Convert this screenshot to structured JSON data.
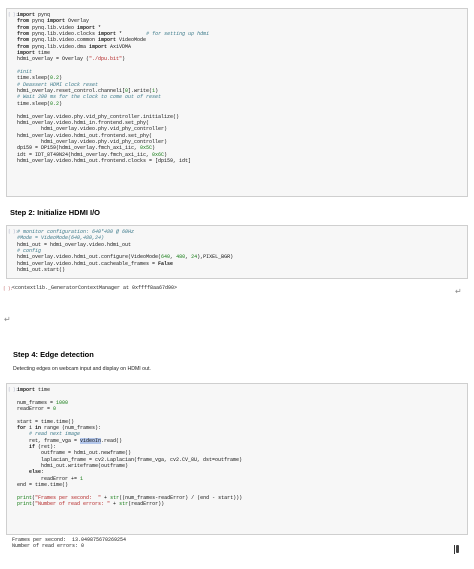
{
  "cell1": {
    "lines": [
      [
        {
          "t": "import",
          "c": "kw"
        },
        {
          "t": " pynq"
        }
      ],
      [
        {
          "t": "from",
          "c": "kw"
        },
        {
          "t": " pynq "
        },
        {
          "t": "import",
          "c": "kw"
        },
        {
          "t": " Overlay"
        }
      ],
      [
        {
          "t": "from",
          "c": "kw"
        },
        {
          "t": " pynq.lib.video "
        },
        {
          "t": "import",
          "c": "kw"
        },
        {
          "t": " *"
        }
      ],
      [
        {
          "t": "from",
          "c": "kw"
        },
        {
          "t": " pynq.lib.video.clocks "
        },
        {
          "t": "import",
          "c": "kw"
        },
        {
          "t": " *        "
        },
        {
          "t": "# for setting up hdmi",
          "c": "cm"
        }
      ],
      [
        {
          "t": "from",
          "c": "kw"
        },
        {
          "t": " pynq.lib.video.common "
        },
        {
          "t": "import",
          "c": "kw"
        },
        {
          "t": " VideoMode"
        }
      ],
      [
        {
          "t": "from",
          "c": "kw"
        },
        {
          "t": " pynq.lib.video.dma "
        },
        {
          "t": "import",
          "c": "kw"
        },
        {
          "t": " AxiVDMA"
        }
      ],
      [
        {
          "t": "import",
          "c": "kw"
        },
        {
          "t": " time"
        }
      ],
      [
        {
          "t": "hdmi_overlay = Overlay ("
        },
        {
          "t": "\"./dpu.bit\"",
          "c": "st"
        },
        {
          "t": ")"
        }
      ],
      [
        {
          "t": ""
        }
      ],
      [
        {
          "t": "#init",
          "c": "cm"
        }
      ],
      [
        {
          "t": "time.sleep("
        },
        {
          "t": "0.2",
          "c": "nm"
        },
        {
          "t": ")"
        }
      ],
      [
        {
          "t": "# Deassert HDMI clock reset",
          "c": "cm"
        }
      ],
      [
        {
          "t": "hdmi_overlay.reset_control.channel1["
        },
        {
          "t": "0",
          "c": "nm"
        },
        {
          "t": "].write("
        },
        {
          "t": "1",
          "c": "nm"
        },
        {
          "t": ")"
        }
      ],
      [
        {
          "t": "# Wait 200 ms for the clock to come out of reset",
          "c": "cm"
        }
      ],
      [
        {
          "t": "time.sleep("
        },
        {
          "t": "0.2",
          "c": "nm"
        },
        {
          "t": ")"
        }
      ],
      [
        {
          "t": ""
        }
      ],
      [
        {
          "t": "hdmi_overlay.video.phy.vid_phy_controller.initialize()"
        }
      ],
      [
        {
          "t": "hdmi_overlay.video.hdmi_in.frontend.set_phy("
        }
      ],
      [
        {
          "t": "        hdmi_overlay.video.phy.vid_phy_controller)"
        }
      ],
      [
        {
          "t": "hdmi_overlay.video.hdmi_out.frontend.set_phy("
        }
      ],
      [
        {
          "t": "        hdmi_overlay.video.phy.vid_phy_controller)"
        }
      ],
      [
        {
          "t": "dp159 = DP159(hdmi_overlay.fmch_axi_iic, "
        },
        {
          "t": "0x5C",
          "c": "nm"
        },
        {
          "t": ")"
        }
      ],
      [
        {
          "t": "idt = IDT_8T49N24(hdmi_overlay.fmch_axi_iic, "
        },
        {
          "t": "0x6C",
          "c": "nm"
        },
        {
          "t": ")"
        }
      ],
      [
        {
          "t": "hdmi_overlay.video.hdmi_out.frontend.clocks = [dp159, idt]"
        }
      ]
    ]
  },
  "heading_step2": "Step 2: Initialize HDMI I/O",
  "cell2": {
    "lines": [
      [
        {
          "t": "# monitor configuration: 640*480 @ 60Hz",
          "c": "cm"
        }
      ],
      [
        {
          "t": "#Mode = VideoMode(640,480,24)",
          "c": "cm"
        }
      ],
      [
        {
          "t": "hdmi_out = hdmi_overlay.video.hdmi_out"
        }
      ],
      [
        {
          "t": "# config",
          "c": "cm"
        }
      ],
      [
        {
          "t": "hdmi_overlay.video.hdmi_out.configure(VideoMode("
        },
        {
          "t": "640",
          "c": "nm"
        },
        {
          "t": ", "
        },
        {
          "t": "480",
          "c": "nm"
        },
        {
          "t": ", "
        },
        {
          "t": "24",
          "c": "nm"
        },
        {
          "t": "),PIXEL_BGR)"
        }
      ],
      [
        {
          "t": "hdmi_overlay.video.hdmi_out.cacheable_frames = "
        },
        {
          "t": "False",
          "c": "kw"
        }
      ],
      [
        {
          "t": "hdmi_out.start()"
        }
      ]
    ],
    "output": "<contextlib._GeneratorContextManager at 0xffff8aa67d90>"
  },
  "heading_step4": "Step 4: Edge detection",
  "para_step4": "Detecting edges on webcam input and display on HDMI out.",
  "cell3": {
    "lines": [
      [
        {
          "t": "import",
          "c": "kw"
        },
        {
          "t": " time"
        }
      ],
      [
        {
          "t": ""
        }
      ],
      [
        {
          "t": "num_frames = "
        },
        {
          "t": "1000",
          "c": "nm"
        }
      ],
      [
        {
          "t": "readError = "
        },
        {
          "t": "0",
          "c": "nm"
        }
      ],
      [
        {
          "t": ""
        }
      ],
      [
        {
          "t": "start = time.time()"
        }
      ],
      [
        {
          "t": "for",
          "c": "kw"
        },
        {
          "t": " i "
        },
        {
          "t": "in",
          "c": "kw"
        },
        {
          "t": " range (num_frames):"
        }
      ],
      [
        {
          "t": "    "
        },
        {
          "t": "# read next image",
          "c": "cm"
        }
      ],
      [
        {
          "t": "    ret, frame_vga = "
        },
        {
          "t": "videoIn",
          "c": "sel"
        },
        {
          "t": ".read()"
        }
      ],
      [
        {
          "t": "    "
        },
        {
          "t": "if",
          "c": "kw"
        },
        {
          "t": " (ret):"
        }
      ],
      [
        {
          "t": "        outframe = hdmi_out.newframe()"
        }
      ],
      [
        {
          "t": "        laplacian_frame = cv2.Laplacian(frame_vga, cv2.CV_8U, dst=outframe)"
        }
      ],
      [
        {
          "t": "        hdmi_out.writeframe(outframe)"
        }
      ],
      [
        {
          "t": "    "
        },
        {
          "t": "else",
          "c": "kw"
        },
        {
          "t": ":"
        }
      ],
      [
        {
          "t": "        readError += "
        },
        {
          "t": "1",
          "c": "nm"
        }
      ],
      [
        {
          "t": "end = time.time()"
        }
      ],
      [
        {
          "t": ""
        }
      ],
      [
        {
          "t": "print",
          "c": "nm"
        },
        {
          "t": "("
        },
        {
          "t": "\"Frames per second:  \"",
          "c": "st"
        },
        {
          "t": " + "
        },
        {
          "t": "str",
          "c": "nm"
        },
        {
          "t": "((num_frames-readError) / (end - start)))"
        }
      ],
      [
        {
          "t": "print",
          "c": "nm"
        },
        {
          "t": "("
        },
        {
          "t": "\"Number of read errors: \"",
          "c": "st"
        },
        {
          "t": " + "
        },
        {
          "t": "str",
          "c": "nm"
        },
        {
          "t": "(readError))"
        }
      ]
    ],
    "output": "Frames per second:  13.049875670269254\nNumber of read errors: 0"
  },
  "prompts": {
    "cell1": "[ ]:",
    "cell2": "[ ]:",
    "out2": "[ ]:",
    "cell3": "[ ]:"
  },
  "marks": {
    "return": "↵"
  }
}
